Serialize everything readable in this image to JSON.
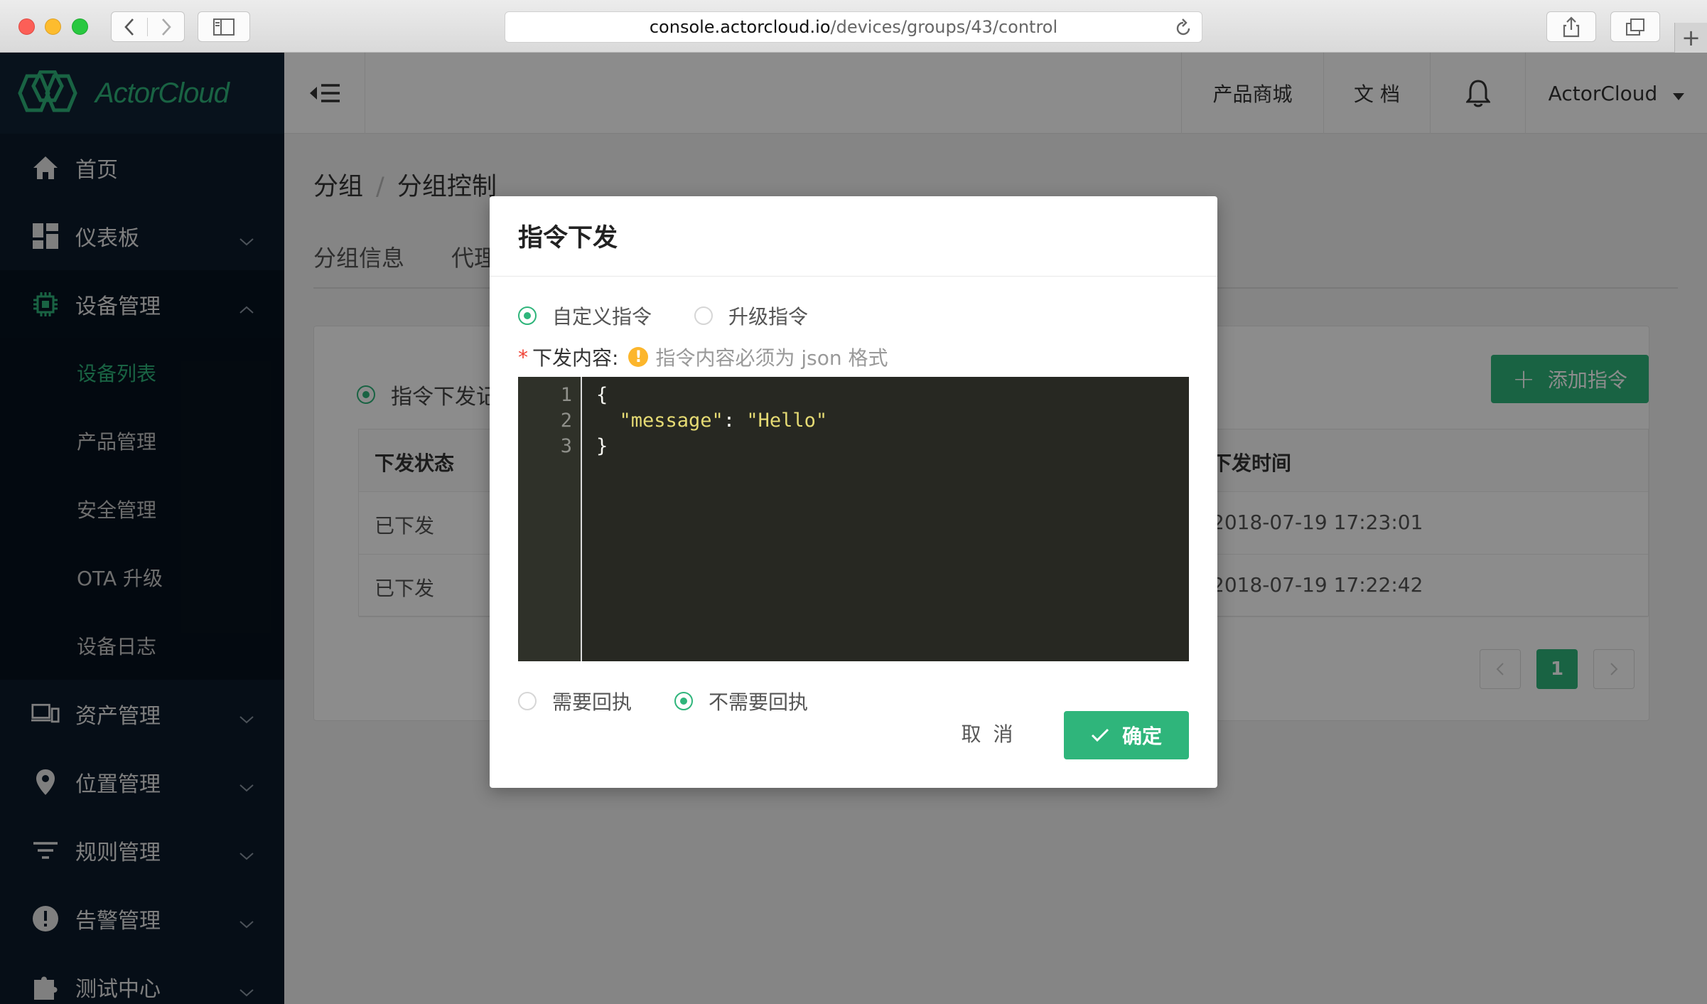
{
  "browser": {
    "url_host": "console.actorcloud.io",
    "url_path": "/devices/groups/43/control"
  },
  "sidebar": {
    "brand": "ActorCloud",
    "items": [
      {
        "label": "首页"
      },
      {
        "label": "仪表板"
      },
      {
        "label": "设备管理"
      }
    ],
    "device_sub": [
      {
        "label": "设备列表"
      },
      {
        "label": "产品管理"
      },
      {
        "label": "安全管理"
      },
      {
        "label": "OTA 升级"
      },
      {
        "label": "设备日志"
      }
    ],
    "items_after": [
      {
        "label": "资产管理"
      },
      {
        "label": "位置管理"
      },
      {
        "label": "规则管理"
      },
      {
        "label": "告警管理"
      },
      {
        "label": "测试中心"
      }
    ]
  },
  "header": {
    "product_store": "产品商城",
    "docs": "文 档",
    "user": "ActorCloud"
  },
  "breadcrumb": {
    "level1": "分组",
    "separator": "/",
    "level2": "分组控制"
  },
  "tabs": [
    "分组信息",
    "代理"
  ],
  "panel": {
    "radio_label": "指令下发记",
    "add_button": "添加指令",
    "table": {
      "col_status": "下发状态",
      "col_time": "下发时间",
      "rows": [
        {
          "status": "已下发",
          "time": "2018-07-19 17:23:01"
        },
        {
          "status": "已下发",
          "time": "2018-07-19 17:22:42"
        }
      ]
    },
    "pagination": {
      "current": "1"
    }
  },
  "modal": {
    "title": "指令下发",
    "type_options": [
      {
        "label": "自定义指令",
        "selected": true
      },
      {
        "label": "升级指令",
        "selected": false
      }
    ],
    "content_label": "下发内容:",
    "content_hint": "指令内容必须为 json 格式",
    "editor_lines": [
      {
        "no": "1",
        "text": "{"
      },
      {
        "no": "2",
        "key": "\"message\"",
        "colon": ": ",
        "value": "\"Hello\""
      },
      {
        "no": "3",
        "text": "}"
      }
    ],
    "ack_options": [
      {
        "label": "需要回执",
        "selected": false
      },
      {
        "label": "不需要回执",
        "selected": true
      }
    ],
    "cancel": "取 消",
    "confirm": "确定"
  },
  "colors": {
    "accent": "#2fb57b",
    "sidebar_bg": "#0b1a2a",
    "editor_bg": "#272822",
    "warning": "#fcb62c"
  }
}
